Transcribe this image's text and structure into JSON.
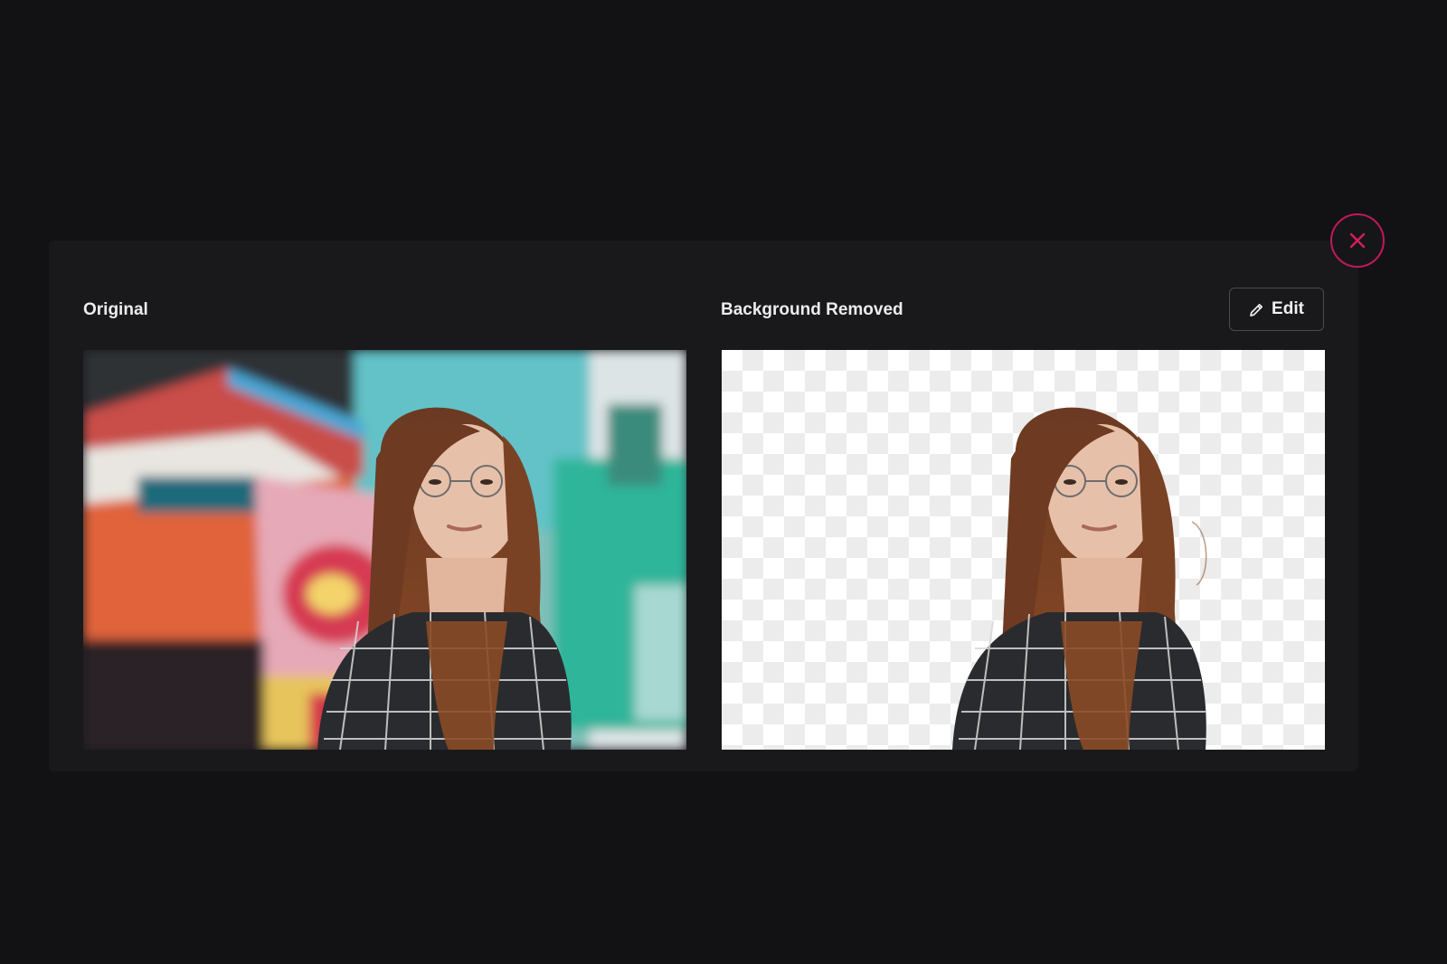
{
  "modal": {
    "close_icon": "close-icon",
    "original_label": "Original",
    "removed_label": "Background Removed",
    "edit_button": {
      "label": "Edit",
      "icon": "pencil-icon"
    }
  },
  "colors": {
    "page_background": "#121215",
    "modal_background": "#19191c",
    "accent": "#c2185b"
  }
}
